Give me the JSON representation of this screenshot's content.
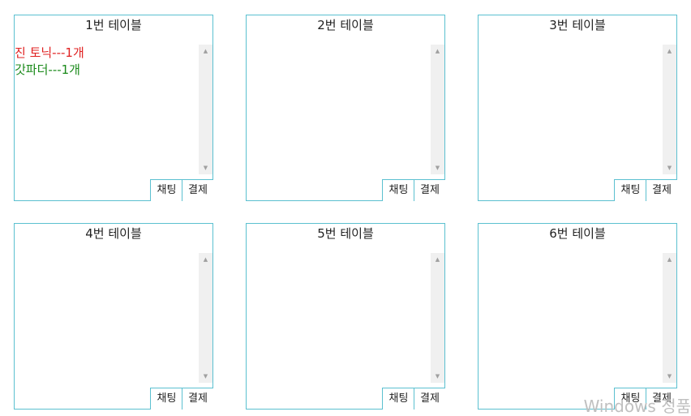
{
  "tables": [
    {
      "title": "1번 테이블",
      "chat_label": "채팅",
      "pay_label": "결제",
      "orders": [
        {
          "text": "진 토닉---1개",
          "color": "#e02020"
        },
        {
          "text": "갓파더---1개",
          "color": "#1a8a1a"
        }
      ]
    },
    {
      "title": "2번 테이블",
      "chat_label": "채팅",
      "pay_label": "결제",
      "orders": []
    },
    {
      "title": "3번 테이블",
      "chat_label": "채팅",
      "pay_label": "결제",
      "orders": []
    },
    {
      "title": "4번 테이블",
      "chat_label": "채팅",
      "pay_label": "결제",
      "orders": []
    },
    {
      "title": "5번 테이블",
      "chat_label": "채팅",
      "pay_label": "결제",
      "orders": []
    },
    {
      "title": "6번 테이블",
      "chat_label": "채팅",
      "pay_label": "결제",
      "orders": []
    }
  ],
  "watermark": "Windows 정품",
  "colors": {
    "border": "#5bc0d0",
    "scroll_track": "#f0f0f0"
  },
  "icons": {
    "scroll_up": "scroll-up-arrow-icon",
    "scroll_down": "scroll-down-arrow-icon"
  }
}
